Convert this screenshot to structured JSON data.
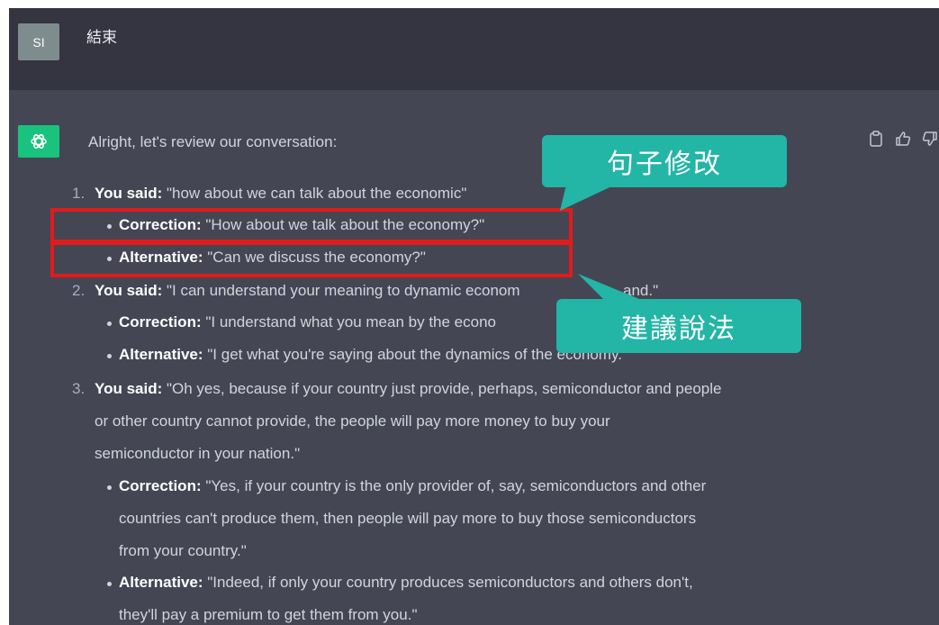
{
  "user_message": {
    "avatar_initials": "SI",
    "text": "結束"
  },
  "assistant": {
    "intro": "Alright, let's review our conversation:",
    "labels": {
      "you_said": "You said:",
      "correction": "Correction:",
      "alternative": "Alternative:"
    },
    "items": [
      {
        "number": "1.",
        "said": "\"how about we can talk about the economic\"",
        "correction": "\"How about we talk about the economy?\"",
        "alternative": "\"Can we discuss the economy?\""
      },
      {
        "number": "2.",
        "said": "\"I can understand your meaning to dynamic econom",
        "said_tail": "and.\"",
        "correction": "\"I understand what you mean by the econo",
        "alternative": "\"I get what you're saying about the dynamics of the economy.\""
      },
      {
        "number": "3.",
        "said_lines": [
          "\"Oh yes, because if your country just provide, perhaps, semiconductor and people",
          "or other country cannot provide, the people will pay more money to buy your",
          "semiconductor in your nation.\""
        ],
        "correction_lines": [
          "\"Yes, if your country is the only provider of, say, semiconductors and other",
          "countries can't produce them, then people will pay more to buy those semiconductors",
          "from your country.\""
        ],
        "alternative_lines": [
          "\"Indeed, if only your country produces semiconductors and others don't,",
          "they'll pay a premium to get them from you.\""
        ]
      }
    ]
  },
  "callouts": {
    "sentence_fix": "句子修改",
    "suggestion": "建議說法"
  },
  "icons": [
    "clipboard-icon",
    "thumbs-up-icon",
    "thumbs-down-icon",
    "openai-logo-icon"
  ],
  "colors": {
    "user_bg": "#343541",
    "assistant_bg": "#444654",
    "gpt_green": "#19c37d",
    "highlight_red": "#e31a1a",
    "callout_teal": "#23b5a6"
  }
}
